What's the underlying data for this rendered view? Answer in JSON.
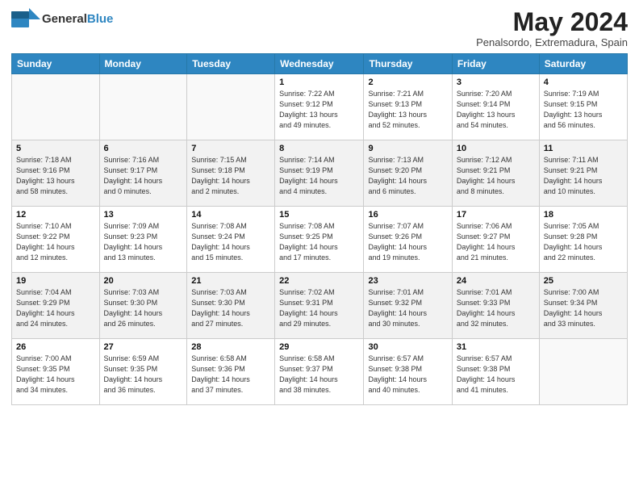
{
  "header": {
    "logo_general": "General",
    "logo_blue": "Blue",
    "month": "May 2024",
    "location": "Penalsordo, Extremadura, Spain"
  },
  "weekdays": [
    "Sunday",
    "Monday",
    "Tuesday",
    "Wednesday",
    "Thursday",
    "Friday",
    "Saturday"
  ],
  "weeks": [
    [
      {
        "day": "",
        "info": ""
      },
      {
        "day": "",
        "info": ""
      },
      {
        "day": "",
        "info": ""
      },
      {
        "day": "1",
        "info": "Sunrise: 7:22 AM\nSunset: 9:12 PM\nDaylight: 13 hours\nand 49 minutes."
      },
      {
        "day": "2",
        "info": "Sunrise: 7:21 AM\nSunset: 9:13 PM\nDaylight: 13 hours\nand 52 minutes."
      },
      {
        "day": "3",
        "info": "Sunrise: 7:20 AM\nSunset: 9:14 PM\nDaylight: 13 hours\nand 54 minutes."
      },
      {
        "day": "4",
        "info": "Sunrise: 7:19 AM\nSunset: 9:15 PM\nDaylight: 13 hours\nand 56 minutes."
      }
    ],
    [
      {
        "day": "5",
        "info": "Sunrise: 7:18 AM\nSunset: 9:16 PM\nDaylight: 13 hours\nand 58 minutes."
      },
      {
        "day": "6",
        "info": "Sunrise: 7:16 AM\nSunset: 9:17 PM\nDaylight: 14 hours\nand 0 minutes."
      },
      {
        "day": "7",
        "info": "Sunrise: 7:15 AM\nSunset: 9:18 PM\nDaylight: 14 hours\nand 2 minutes."
      },
      {
        "day": "8",
        "info": "Sunrise: 7:14 AM\nSunset: 9:19 PM\nDaylight: 14 hours\nand 4 minutes."
      },
      {
        "day": "9",
        "info": "Sunrise: 7:13 AM\nSunset: 9:20 PM\nDaylight: 14 hours\nand 6 minutes."
      },
      {
        "day": "10",
        "info": "Sunrise: 7:12 AM\nSunset: 9:21 PM\nDaylight: 14 hours\nand 8 minutes."
      },
      {
        "day": "11",
        "info": "Sunrise: 7:11 AM\nSunset: 9:21 PM\nDaylight: 14 hours\nand 10 minutes."
      }
    ],
    [
      {
        "day": "12",
        "info": "Sunrise: 7:10 AM\nSunset: 9:22 PM\nDaylight: 14 hours\nand 12 minutes."
      },
      {
        "day": "13",
        "info": "Sunrise: 7:09 AM\nSunset: 9:23 PM\nDaylight: 14 hours\nand 13 minutes."
      },
      {
        "day": "14",
        "info": "Sunrise: 7:08 AM\nSunset: 9:24 PM\nDaylight: 14 hours\nand 15 minutes."
      },
      {
        "day": "15",
        "info": "Sunrise: 7:08 AM\nSunset: 9:25 PM\nDaylight: 14 hours\nand 17 minutes."
      },
      {
        "day": "16",
        "info": "Sunrise: 7:07 AM\nSunset: 9:26 PM\nDaylight: 14 hours\nand 19 minutes."
      },
      {
        "day": "17",
        "info": "Sunrise: 7:06 AM\nSunset: 9:27 PM\nDaylight: 14 hours\nand 21 minutes."
      },
      {
        "day": "18",
        "info": "Sunrise: 7:05 AM\nSunset: 9:28 PM\nDaylight: 14 hours\nand 22 minutes."
      }
    ],
    [
      {
        "day": "19",
        "info": "Sunrise: 7:04 AM\nSunset: 9:29 PM\nDaylight: 14 hours\nand 24 minutes."
      },
      {
        "day": "20",
        "info": "Sunrise: 7:03 AM\nSunset: 9:30 PM\nDaylight: 14 hours\nand 26 minutes."
      },
      {
        "day": "21",
        "info": "Sunrise: 7:03 AM\nSunset: 9:30 PM\nDaylight: 14 hours\nand 27 minutes."
      },
      {
        "day": "22",
        "info": "Sunrise: 7:02 AM\nSunset: 9:31 PM\nDaylight: 14 hours\nand 29 minutes."
      },
      {
        "day": "23",
        "info": "Sunrise: 7:01 AM\nSunset: 9:32 PM\nDaylight: 14 hours\nand 30 minutes."
      },
      {
        "day": "24",
        "info": "Sunrise: 7:01 AM\nSunset: 9:33 PM\nDaylight: 14 hours\nand 32 minutes."
      },
      {
        "day": "25",
        "info": "Sunrise: 7:00 AM\nSunset: 9:34 PM\nDaylight: 14 hours\nand 33 minutes."
      }
    ],
    [
      {
        "day": "26",
        "info": "Sunrise: 7:00 AM\nSunset: 9:35 PM\nDaylight: 14 hours\nand 34 minutes."
      },
      {
        "day": "27",
        "info": "Sunrise: 6:59 AM\nSunset: 9:35 PM\nDaylight: 14 hours\nand 36 minutes."
      },
      {
        "day": "28",
        "info": "Sunrise: 6:58 AM\nSunset: 9:36 PM\nDaylight: 14 hours\nand 37 minutes."
      },
      {
        "day": "29",
        "info": "Sunrise: 6:58 AM\nSunset: 9:37 PM\nDaylight: 14 hours\nand 38 minutes."
      },
      {
        "day": "30",
        "info": "Sunrise: 6:57 AM\nSunset: 9:38 PM\nDaylight: 14 hours\nand 40 minutes."
      },
      {
        "day": "31",
        "info": "Sunrise: 6:57 AM\nSunset: 9:38 PM\nDaylight: 14 hours\nand 41 minutes."
      },
      {
        "day": "",
        "info": ""
      }
    ]
  ]
}
